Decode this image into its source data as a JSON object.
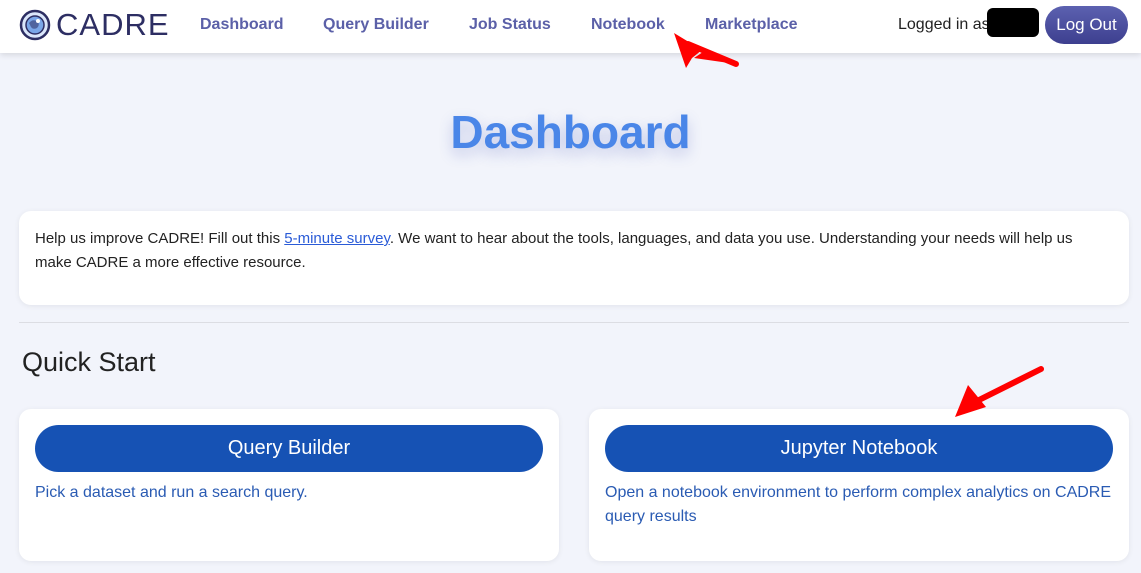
{
  "brand": {
    "name": "CADRE",
    "logo_icon": "cadre-globe-logo"
  },
  "nav": {
    "links": [
      "Dashboard",
      "Query Builder",
      "Job Status",
      "Notebook",
      "Marketplace"
    ],
    "logged_in_label": "Logged in as",
    "logout_label": "Log Out"
  },
  "page": {
    "title": "Dashboard"
  },
  "survey": {
    "text_before": "Help us improve CADRE! Fill out this ",
    "link_text": "5-minute survey",
    "text_after": ". We want to hear about the tools, languages, and data you use. Understanding your needs will help us make CADRE a more effective resource."
  },
  "quick_start": {
    "title": "Quick Start",
    "cards": [
      {
        "button": "Query Builder",
        "description": "Pick a dataset and run a search query."
      },
      {
        "button": "Jupyter Notebook",
        "description": "Open a notebook environment to perform complex analytics on CADRE query results"
      }
    ]
  },
  "annotations": {
    "arrow_color": "#ff0000"
  },
  "colors": {
    "accent": "#4a86e8",
    "nav_link": "#5b60a8",
    "button": "#1652b4"
  }
}
